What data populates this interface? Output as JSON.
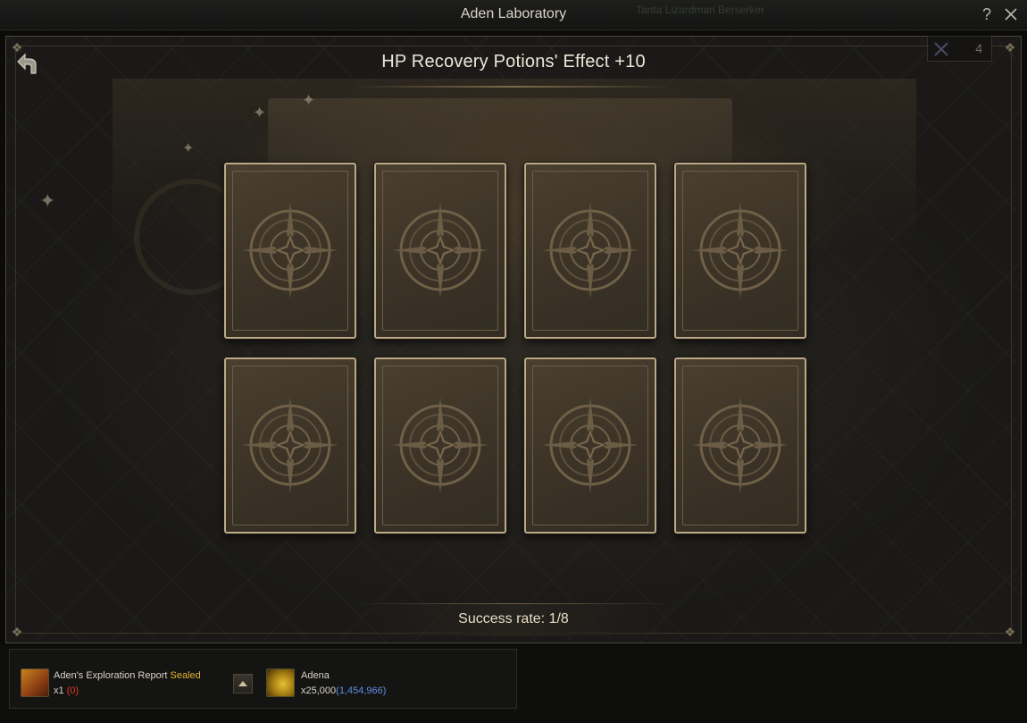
{
  "window": {
    "title": "Aden Laboratory",
    "background_name": "Tanta Lizardman Berserker"
  },
  "header": {
    "title": "HP Recovery Potions' Effect +10",
    "counter": "4"
  },
  "cards": [
    {
      "state": "face-down"
    },
    {
      "state": "face-down"
    },
    {
      "state": "face-down"
    },
    {
      "state": "face-down"
    },
    {
      "state": "face-down"
    },
    {
      "state": "face-down"
    },
    {
      "state": "face-down"
    },
    {
      "state": "face-down"
    }
  ],
  "success": {
    "label": "Success rate:",
    "value": "1/8"
  },
  "costs": {
    "report": {
      "name": "Aden's Exploration Report",
      "tag": "Sealed",
      "qty": "x1",
      "owned": "(0)"
    },
    "adena": {
      "name": "Adena",
      "qty": "x25,000",
      "owned": "(1,454,966)"
    }
  },
  "icons": {
    "help": "help-icon",
    "close": "close-icon",
    "back": "back-arrow-icon",
    "arrow": "arrow-up-icon"
  },
  "colors": {
    "accent_gold": "#e6b431",
    "owned_zero": "#e23c2a",
    "owned_amount": "#5f8de0",
    "card_border": "#bca987"
  }
}
